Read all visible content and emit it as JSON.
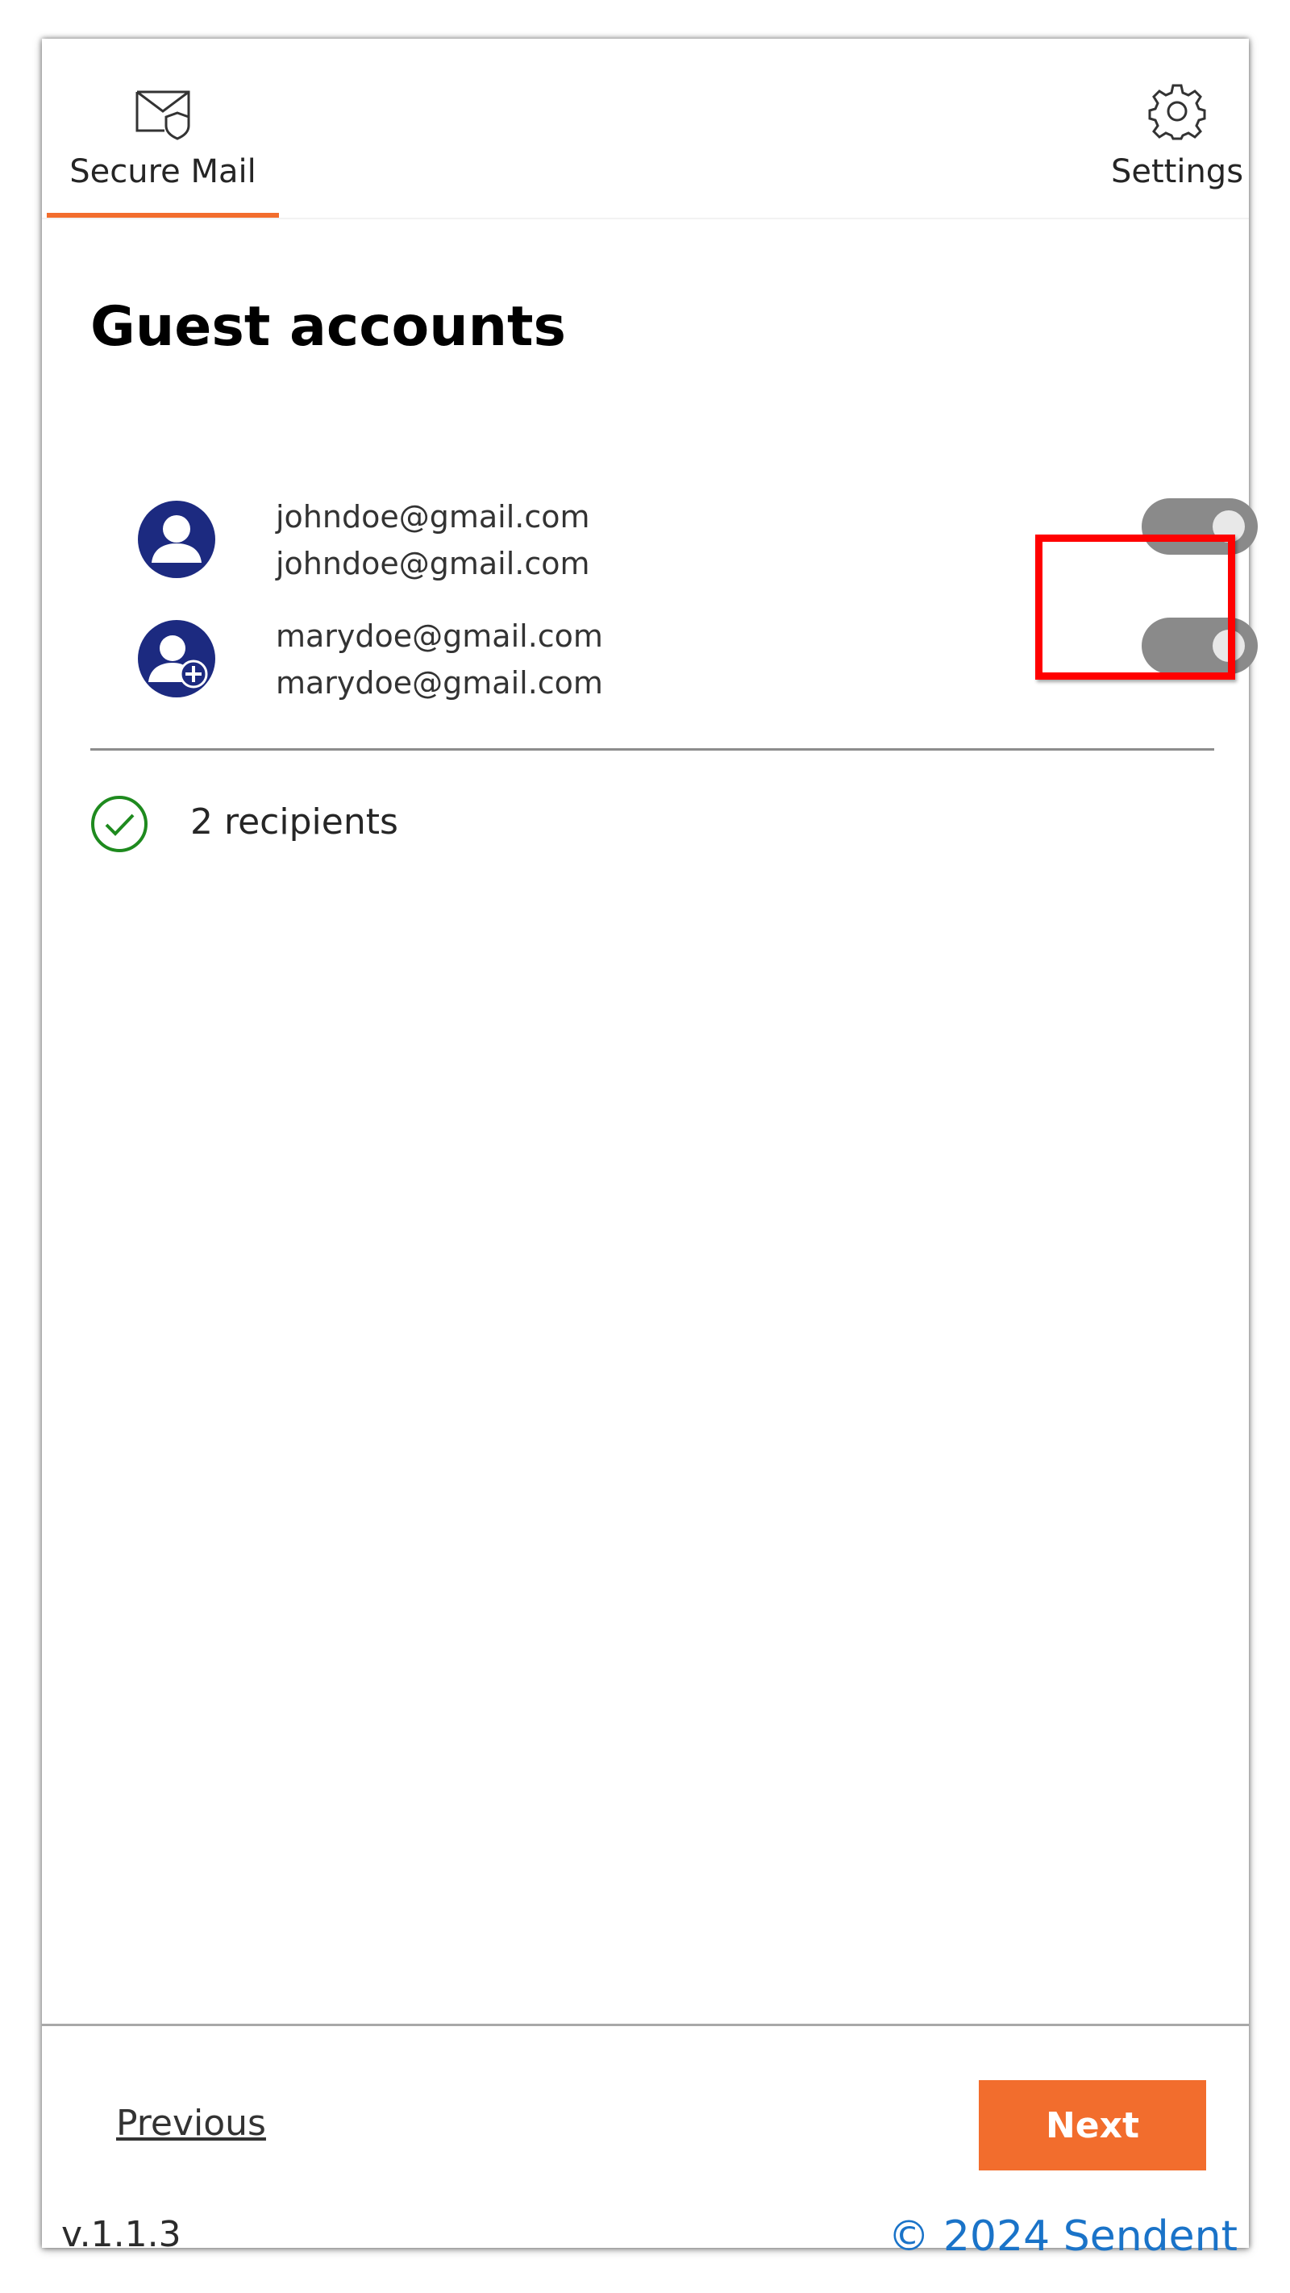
{
  "tabs": {
    "secure_mail": {
      "label": "Secure Mail",
      "icon": "mail-shield-icon",
      "active": true
    },
    "settings": {
      "label": "Settings",
      "icon": "gear-icon"
    }
  },
  "page": {
    "title": "Guest accounts"
  },
  "accounts": [
    {
      "line1": "johndoe@gmail.com",
      "line2": "johndoe@gmail.com",
      "avatar_icon": "person-icon",
      "toggle_on": true
    },
    {
      "line1": "marydoe@gmail.com",
      "line2": "marydoe@gmail.com",
      "avatar_icon": "person-add-icon",
      "toggle_on": true
    }
  ],
  "summary": {
    "text": "2 recipients",
    "icon": "check-circle-icon"
  },
  "footer": {
    "previous_label": "Previous",
    "next_label": "Next",
    "version": "v.1.1.3",
    "copyright": "© 2024 Sendent"
  },
  "colors": {
    "accent": "#f26d2d",
    "avatar": "#1c2a80",
    "toggle": "#8a8a8a",
    "check": "#1e8a1e",
    "link": "#1a73c8",
    "highlight": "#ff0000"
  }
}
